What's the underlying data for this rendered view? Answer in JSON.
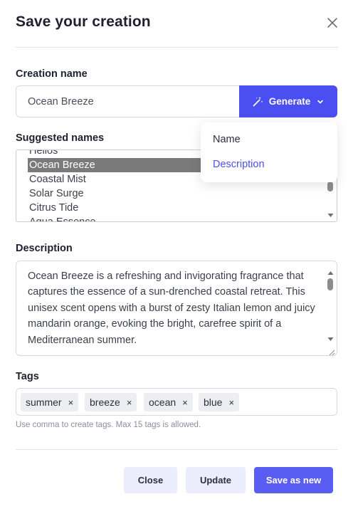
{
  "dialog": {
    "title": "Save your creation",
    "close_icon": "close-icon"
  },
  "creation_name": {
    "label": "Creation name",
    "value": "Ocean Breeze"
  },
  "generate": {
    "label": "Generate",
    "icon": "magic-wand-icon",
    "chevron_icon": "chevron-down-icon",
    "accent": "#4b4ef0",
    "menu": [
      {
        "label": "Name",
        "color": "#2c303d"
      },
      {
        "label": "Description",
        "color": "#4b4ef0"
      }
    ]
  },
  "suggested": {
    "label": "Suggested names",
    "items": [
      "Helios",
      "Ocean Breeze",
      "Coastal Mist",
      "Solar Surge",
      "Citrus Tide",
      "Aqua Essence"
    ],
    "selected": "Ocean Breeze"
  },
  "description": {
    "label": "Description",
    "text": "Ocean Breeze is a refreshing and invigorating fragrance that captures the essence of a sun-drenched coastal retreat. This unisex scent opens with a burst of zesty Italian lemon and juicy mandarin orange, evoking the bright, carefree spirit of a Mediterranean summer."
  },
  "tags": {
    "label": "Tags",
    "items": [
      "summer",
      "breeze",
      "ocean",
      "blue"
    ],
    "remove_glyph": "×",
    "helper": "Use comma to create tags. Max 15 tags is allowed."
  },
  "footer": {
    "close_label": "Close",
    "update_label": "Update",
    "save_new_label": "Save as new"
  }
}
